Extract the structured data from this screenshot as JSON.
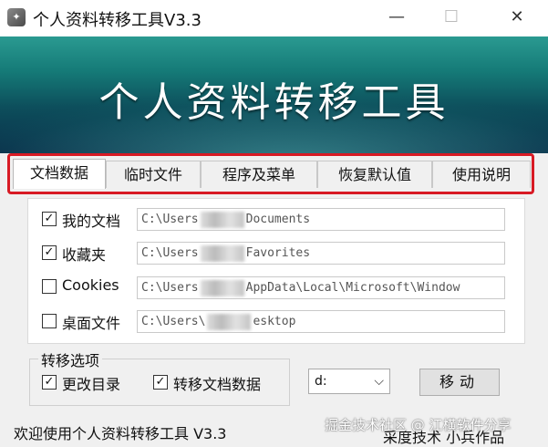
{
  "window": {
    "title": "个人资料转移工具V3.3",
    "min_glyph": "—",
    "max_glyph": "☐",
    "close_glyph": "✕"
  },
  "banner": {
    "title": "个人资料转移工具"
  },
  "tabs": [
    {
      "label": "文档数据",
      "active": true
    },
    {
      "label": "临时文件",
      "active": false
    },
    {
      "label": "程序及菜单",
      "active": false
    },
    {
      "label": "恢复默认值",
      "active": false
    },
    {
      "label": "使用说明",
      "active": false
    }
  ],
  "rows": [
    {
      "label": "我的文档",
      "checked": true,
      "path_pre": "C:\\Users",
      "path_post": "Documents"
    },
    {
      "label": "收藏夹",
      "checked": true,
      "path_pre": "C:\\Users",
      "path_post": "Favorites"
    },
    {
      "label": "Cookies",
      "checked": false,
      "path_pre": "C:\\Users",
      "path_post": "AppData\\Local\\Microsoft\\Window"
    },
    {
      "label": "桌面文件",
      "checked": false,
      "path_pre": "C:\\Users\\",
      "path_post": "esktop"
    }
  ],
  "options": {
    "title": "转移选项",
    "change_dir": {
      "label": "更改目录",
      "checked": true
    },
    "move_docs": {
      "label": "转移文档数据",
      "checked": true
    }
  },
  "drive": {
    "value": "d:"
  },
  "move_button": {
    "label": "移动"
  },
  "status": {
    "left": "欢迎使用个人资料转移工具 V3.3",
    "right": "采度技术 小兵作品"
  },
  "watermark": {
    "text": "掘金技术社区 @ 江横软件分享"
  },
  "colors": {
    "highlight_border": "#d81a24",
    "banner_top": "#2a9a91",
    "banner_bottom": "#0a2f4a"
  }
}
